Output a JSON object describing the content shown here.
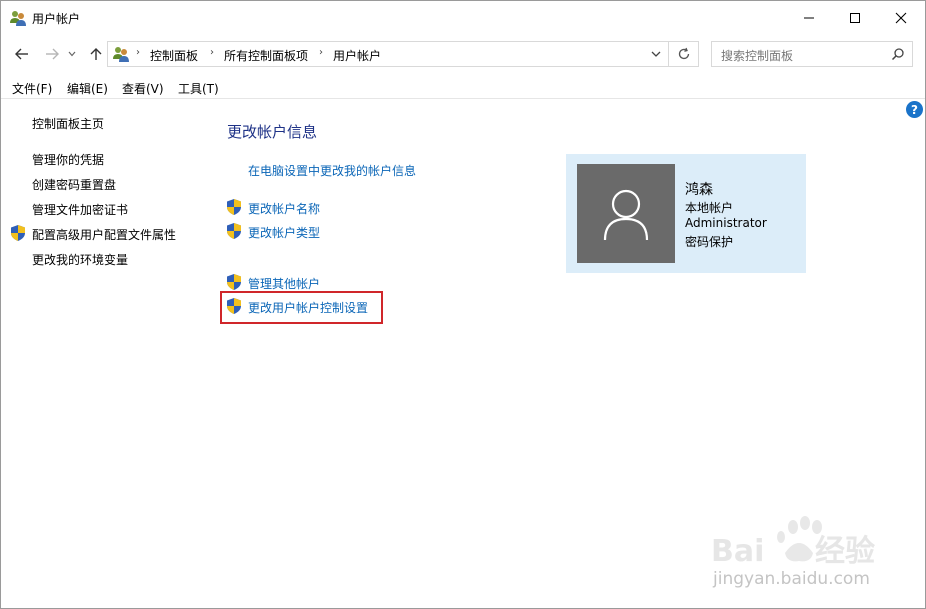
{
  "window": {
    "title": "用户帐户",
    "controls": [
      "minimize",
      "maximize",
      "close"
    ]
  },
  "navigation": {
    "breadcrumbs": [
      "控制面板",
      "所有控制面板项",
      "用户帐户"
    ],
    "search_placeholder": "搜索控制面板"
  },
  "menubar": {
    "items": [
      "文件(F)",
      "编辑(E)",
      "查看(V)",
      "工具(T)"
    ]
  },
  "left_pane": {
    "home": "控制面板主页",
    "links": [
      {
        "label": "管理你的凭据",
        "shield": false
      },
      {
        "label": "创建密码重置盘",
        "shield": false
      },
      {
        "label": "管理文件加密证书",
        "shield": false
      },
      {
        "label": "配置高级用户配置文件属性",
        "shield": true
      },
      {
        "label": "更改我的环境变量",
        "shield": false
      }
    ]
  },
  "main": {
    "heading": "更改帐户信息",
    "pc_settings_link": "在电脑设置中更改我的帐户信息",
    "links_group1": [
      "更改帐户名称",
      "更改帐户类型"
    ],
    "links_group2": [
      "管理其他帐户",
      "更改用户帐户控制设置"
    ],
    "highlighted_link": "更改用户帐户控制设置"
  },
  "account": {
    "name": "鸿森",
    "type": "本地帐户",
    "group": "Administrator",
    "protection": "密码保护"
  },
  "watermark": {
    "logo_text": "Baidu经验",
    "url": "jingyan.baidu.com"
  },
  "colors": {
    "link": "#0b66b7",
    "heading": "#1e3287",
    "card_background": "#dcedf9",
    "highlight_border": "#d0262a",
    "avatar_background": "#6a6a6a"
  },
  "icons": {
    "help": "?"
  }
}
